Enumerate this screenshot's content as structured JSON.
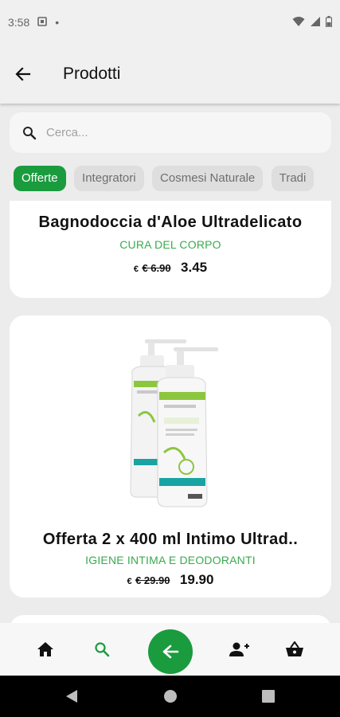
{
  "status_bar": {
    "time": "3:58",
    "dot": "•"
  },
  "app_bar": {
    "title": "Prodotti"
  },
  "search": {
    "placeholder": "Cerca..."
  },
  "categories": [
    {
      "label": "Offerte",
      "active": true
    },
    {
      "label": "Integratori",
      "active": false
    },
    {
      "label": "Cosmesi Naturale",
      "active": false
    },
    {
      "label": "Tradi",
      "active": false
    }
  ],
  "products": [
    {
      "name": "Bagnodoccia d'Aloe Ultradelicato",
      "category": "CURA DEL CORPO",
      "currency": "€",
      "old_price": "€ 6.90",
      "price": "3.45"
    },
    {
      "name": "Offerta 2 x 400 ml  Intimo Ultrad..",
      "category": "IGIENE INTIMA E DEODORANTI",
      "currency": "€",
      "old_price": "€ 29.90",
      "price": "19.90",
      "image": "bottle-image"
    }
  ],
  "bottom_nav": [
    "home-icon",
    "search-icon",
    "back-arrow-icon",
    "add-user-icon",
    "basket-icon"
  ],
  "colors": {
    "accent": "#1a9b3e",
    "category_text": "#3aaa4f"
  }
}
